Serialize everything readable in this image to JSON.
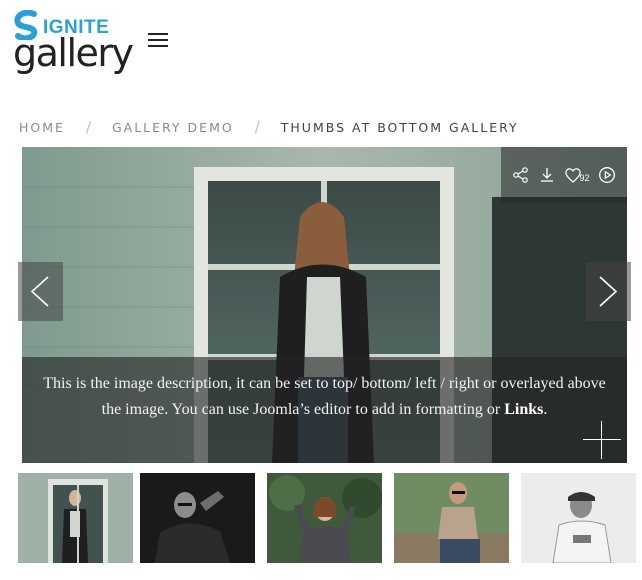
{
  "brand": {
    "top_word": "IGNITE",
    "bottom_word": "gallery",
    "accent_color": "#2aa0d6"
  },
  "header": {
    "menu_icon": "hamburger-icon"
  },
  "breadcrumb": {
    "items": [
      {
        "label": "HOME"
      },
      {
        "label": "GALLERY DEMO"
      },
      {
        "label": "THUMBS AT BOTTOM GALLERY"
      }
    ],
    "separator": "/"
  },
  "toolbar": {
    "share_icon": "share-icon",
    "download_icon": "download-icon",
    "like_icon": "heart-icon",
    "like_count": "92",
    "slideshow_icon": "play-icon"
  },
  "caption": {
    "text": "This is the image description, it can be set to top/ bottom/ left / right or overlayed above the image. You can use Joomla’s editor to add in formatting or",
    "link_text": "Links",
    "trailing": "."
  },
  "navigation": {
    "prev_icon": "chevron-left-icon",
    "next_icon": "chevron-right-icon",
    "expand_icon": "plus-icon"
  },
  "thumbnails": [
    {
      "index": 1,
      "tone": "color"
    },
    {
      "index": 2,
      "tone": "bw"
    },
    {
      "index": 3,
      "tone": "color"
    },
    {
      "index": 4,
      "tone": "color"
    },
    {
      "index": 5,
      "tone": "bw"
    }
  ]
}
